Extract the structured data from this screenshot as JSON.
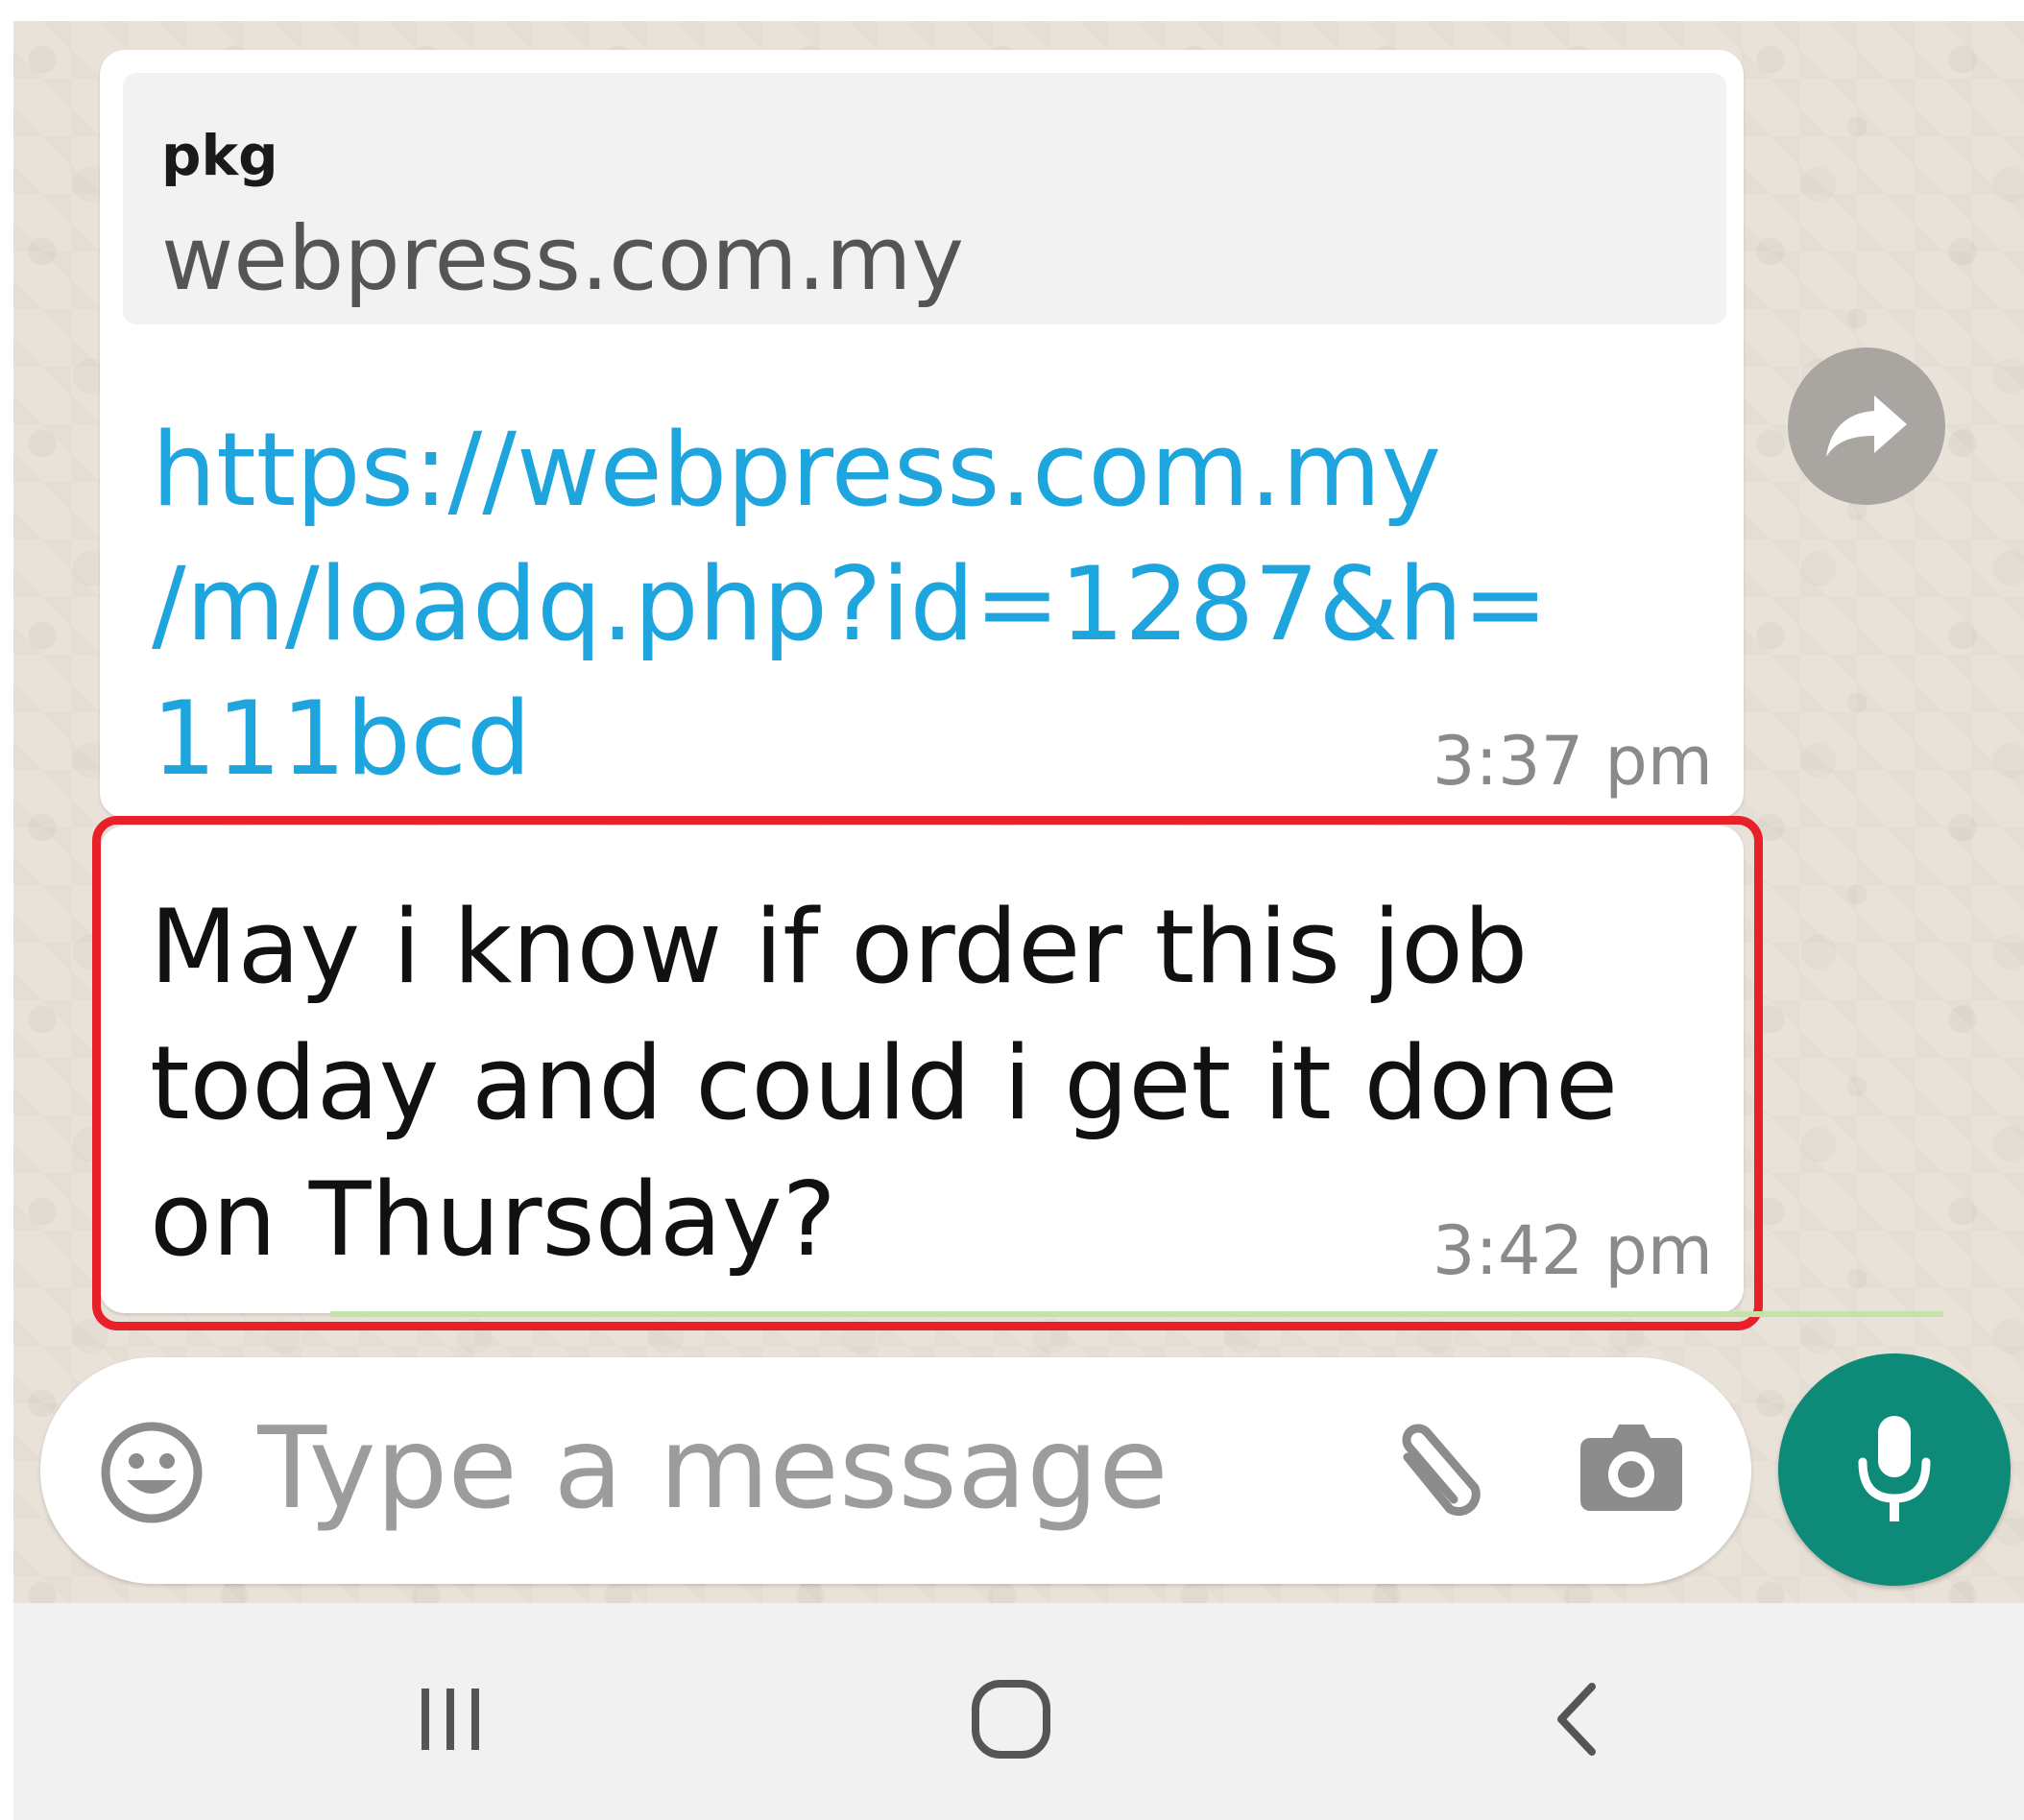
{
  "colors": {
    "chat_background": "#e9e2d8",
    "link": "#1fa5de",
    "timestamp": "#8a8a8a",
    "highlight_border": "#e8202a",
    "mic_button": "#0e8a78",
    "forward_button": "#a9a6a1"
  },
  "messages": [
    {
      "preview": {
        "title": "pkg",
        "domain": "webpress.com.my"
      },
      "text": "https://webpress.com.my\n/m/loadq.php?id=1287&h=\n111bcd",
      "time": "3:37 pm"
    },
    {
      "text": "May i know if order this job\ntoday and could i get it done\non Thursday?",
      "time": "3:42 pm",
      "highlighted": true
    }
  ],
  "forward_icon": "forward-icon",
  "composer": {
    "placeholder": "Type a message",
    "icons": [
      "emoji-icon",
      "paperclip-icon",
      "camera-icon"
    ],
    "mic_icon": "microphone-icon"
  },
  "navigation": {
    "buttons": [
      "recents-icon",
      "home-icon",
      "back-icon"
    ]
  }
}
